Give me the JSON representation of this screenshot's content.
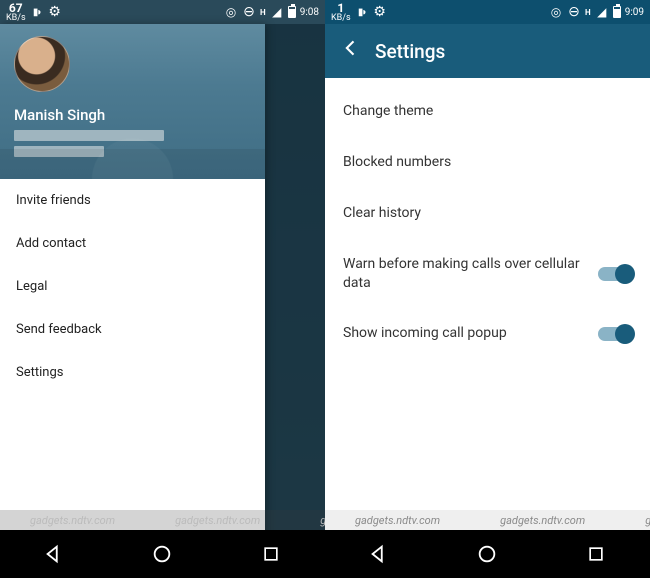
{
  "left": {
    "statusbar": {
      "speed_value": "67",
      "speed_unit": "KB/s",
      "net_label": "H",
      "time": "9:08"
    },
    "profile": {
      "name": "Manish Singh"
    },
    "menu": [
      "Invite friends",
      "Add contact",
      "Legal",
      "Send feedback",
      "Settings"
    ]
  },
  "right": {
    "statusbar": {
      "speed_value": "1",
      "speed_unit": "KB/s",
      "net_label": "H",
      "time": "9:09"
    },
    "title": "Settings",
    "items": {
      "change_theme": "Change theme",
      "blocked_numbers": "Blocked numbers",
      "clear_history": "Clear history",
      "warn_cellular": "Warn before making calls over cellular data",
      "incoming_popup": "Show incoming call popup"
    }
  },
  "watermark": "gadgets.ndtv.com"
}
